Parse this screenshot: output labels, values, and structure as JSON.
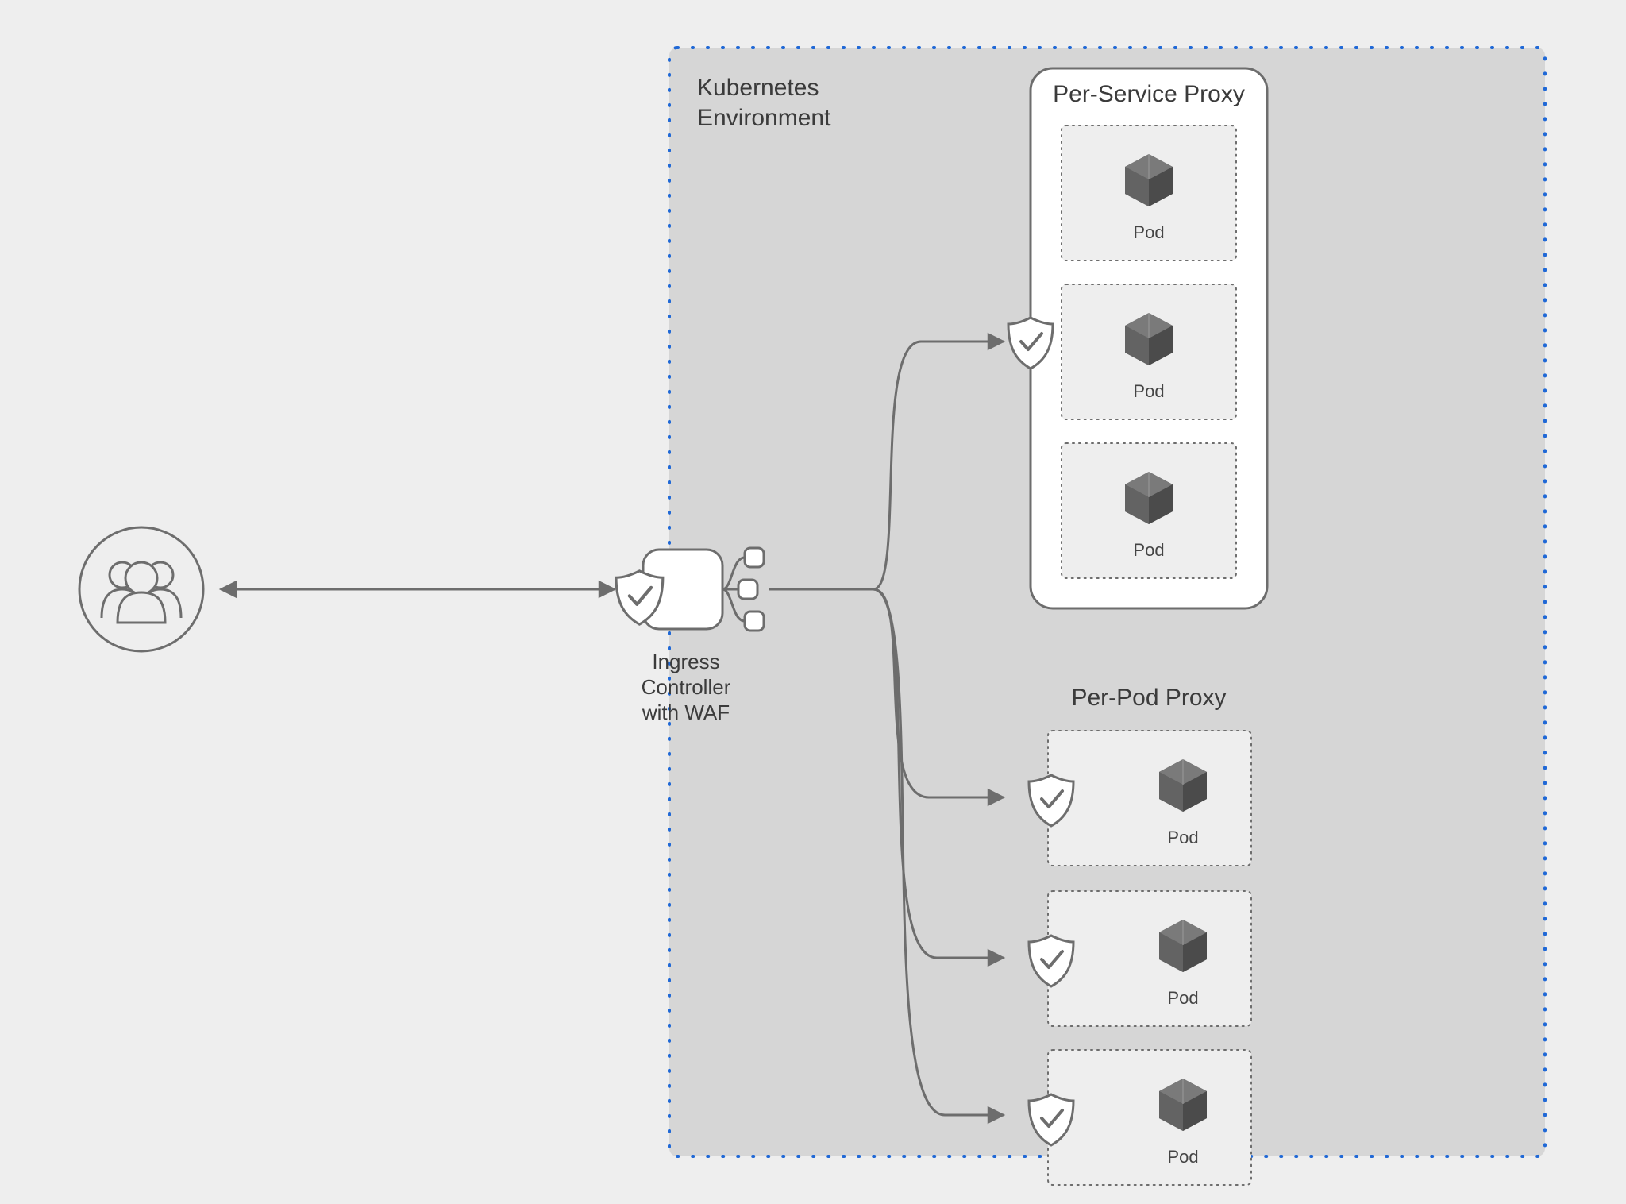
{
  "boundary": {
    "title_line1": "Kubernetes",
    "title_line2": "Environment"
  },
  "users": {
    "label": ""
  },
  "ingress": {
    "line1": "Ingress",
    "line2": "Controller",
    "line3": "with WAF"
  },
  "per_service": {
    "title": "Per-Service Proxy",
    "pods": [
      {
        "label": "Pod"
      },
      {
        "label": "Pod"
      },
      {
        "label": "Pod"
      }
    ]
  },
  "per_pod": {
    "title": "Per-Pod Proxy",
    "pods": [
      {
        "label": "Pod"
      },
      {
        "label": "Pod"
      },
      {
        "label": "Pod"
      }
    ]
  }
}
